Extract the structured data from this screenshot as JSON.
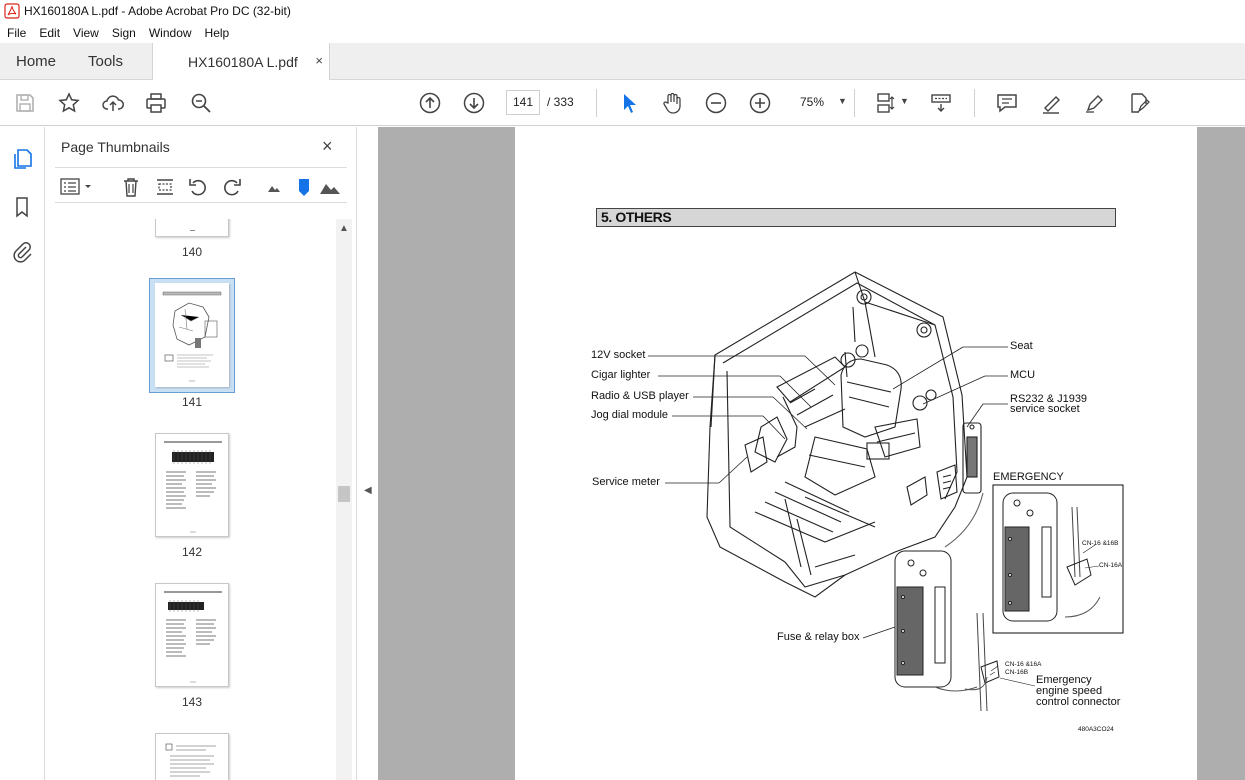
{
  "window": {
    "title": "HX160180A L.pdf - Adobe Acrobat Pro DC (32-bit)"
  },
  "menu": [
    "File",
    "Edit",
    "View",
    "Sign",
    "Window",
    "Help"
  ],
  "tabs": {
    "home": "Home",
    "tools": "Tools",
    "document": "HX160180A L.pdf",
    "close": "×"
  },
  "toolbar": {
    "current_page": "141",
    "total_pages": "/ 333",
    "zoom": "75%"
  },
  "panel": {
    "title": "Page Thumbnails",
    "close": "×"
  },
  "thumbnails": [
    {
      "label": "140"
    },
    {
      "label": "141",
      "selected": true
    },
    {
      "label": "142"
    },
    {
      "label": "143"
    }
  ],
  "document": {
    "section_title": "5. OTHERS",
    "callouts": {
      "socket12v": "12V socket",
      "cigar": "Cigar lighter",
      "radio": "Radio & USB player",
      "jog": "Jog dial module",
      "service_meter": "Service meter",
      "seat": "Seat",
      "mcu": "MCU",
      "rs232_line1": "RS232 & J1939",
      "rs232_line2": "service socket",
      "emergency": "EMERGENCY",
      "fuse": "Fuse & relay box",
      "emerg_speed_1": "Emergency",
      "emerg_speed_2": "engine speed",
      "emerg_speed_3": "control connector",
      "cn16_16b": "CN-16 &16B",
      "cn16a": "CN-16A",
      "cn16_16a": "CN-16 &16A",
      "cn16b": "CN-16B",
      "figure_code": "480A3CO24"
    }
  },
  "colors": {
    "accent_blue": "#1473e6",
    "pdf_red": "#d9241c",
    "doc_bg": "#aeaeae"
  }
}
